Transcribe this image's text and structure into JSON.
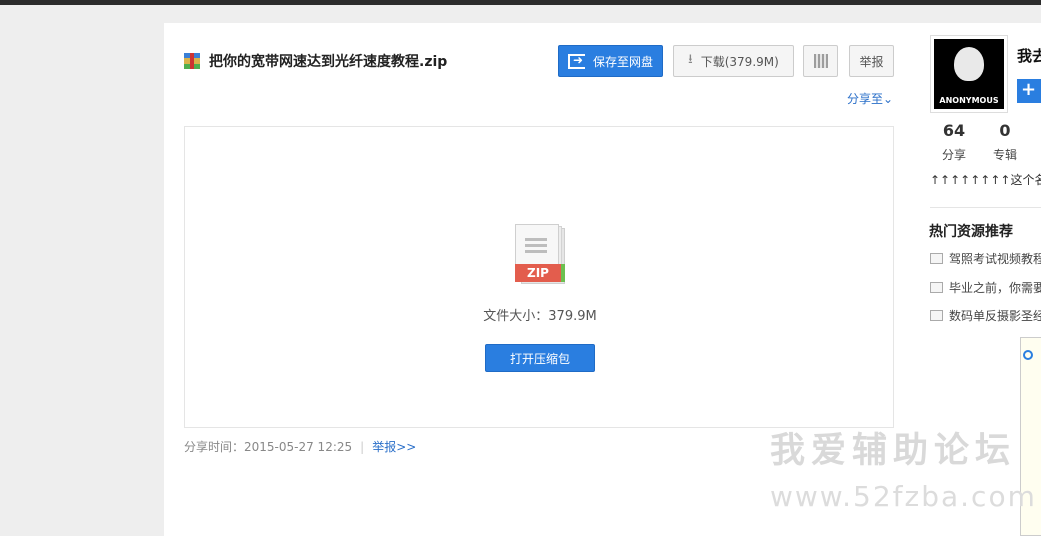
{
  "file": {
    "title": "把你的宽带网速达到光纤速度教程.zip",
    "size_text": "文件大小：379.9M",
    "zip_label": "ZIP"
  },
  "toolbar": {
    "save_label": "保存至网盘",
    "download_label": "下载(379.9M)",
    "report_label": "举报",
    "share_to_label": "分享至",
    "share_to_icon": "chevron-down-icon"
  },
  "preview": {
    "open_label": "打开压缩包"
  },
  "meta": {
    "share_time": "分享时间：2015-05-27 12:25",
    "separator": "|",
    "report_link": "举报>>"
  },
  "sidebar": {
    "avatar_text": "ANONYMOUS",
    "user_name": "我去",
    "follow_label": "+",
    "stats": [
      {
        "num": "64",
        "label": "分享"
      },
      {
        "num": "0",
        "label": "专辑"
      }
    ],
    "signature": "↑↑↑↑↑↑↑↑这个名字不",
    "hot_title": "热门资源推荐",
    "hot_items": [
      "驾照考试视频教程",
      "毕业之前，你需要",
      "数码单反摄影圣经"
    ]
  },
  "watermark": {
    "line1": "我爱辅助论坛",
    "line2": "www.52fzba.com"
  },
  "colors": {
    "accent": "#2a7ee0",
    "link": "#2a6fc9",
    "background": "#eeeeee"
  }
}
